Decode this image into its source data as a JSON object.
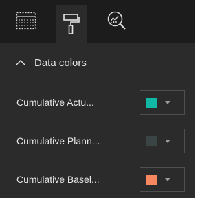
{
  "toolbar": {
    "icons": [
      "fields-icon",
      "format-paint-roller-icon",
      "analytics-magnifier-icon"
    ],
    "active": "format-paint-roller-icon"
  },
  "section": {
    "title": "Data colors",
    "expanded": true
  },
  "series": [
    {
      "label": "Cumulative Actu...",
      "color": "#12b8a6"
    },
    {
      "label": "Cumulative Plann...",
      "color": "#3a4444"
    },
    {
      "label": "Cumulative Basel...",
      "color": "#f7875f"
    }
  ],
  "colors": {
    "panel_bg": "#2b2b2b",
    "topbar_bg": "#1c1c1c",
    "text": "#e6e6e6"
  }
}
